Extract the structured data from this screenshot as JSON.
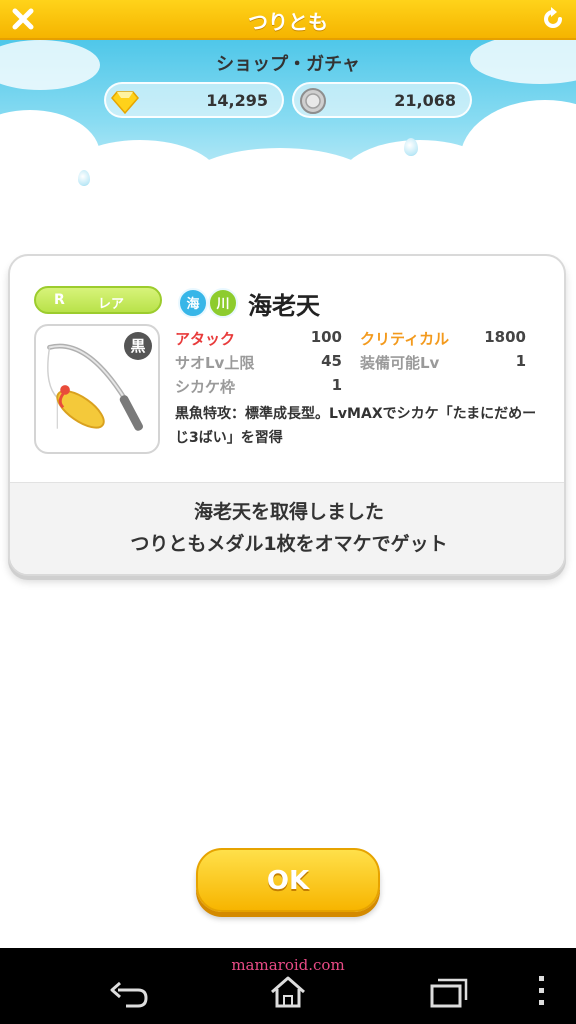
{
  "titlebar": {
    "title": "つりとも",
    "close_icon": "close-icon",
    "refresh_icon": "refresh-icon"
  },
  "header": {
    "section": "ショップ・ガチャ",
    "gems": "14,295",
    "coins": "21,068"
  },
  "item": {
    "rarity_letter": "R",
    "rarity_label": "レア",
    "class_badge": "黒",
    "tags": [
      "海",
      "川"
    ],
    "name": "海老天",
    "stats": {
      "attack_label": "アタック",
      "attack_value": "100",
      "critical_label": "クリティカル",
      "critical_value": "1800",
      "rod_lv_label": "サオLv上限",
      "rod_lv_value": "45",
      "equip_lv_label": "装備可能Lv",
      "equip_lv_value": "1",
      "slot_label": "シカケ枠",
      "slot_value": "1"
    },
    "description": "黒魚特攻：標準成長型。LvMAXでシカケ「たまにだめーじ3ばい」を習得"
  },
  "messages": {
    "line1": "海老天を取得しました",
    "line2": "つりともメダル1枚をオマケでゲット"
  },
  "ok_button": "OK",
  "navbar": {
    "watermark": "mamaroid.com"
  },
  "colors": {
    "accent": "#f7b500",
    "sky": "#4fc7e9",
    "attack": "#e83b3b",
    "critical": "#f39a1d"
  }
}
